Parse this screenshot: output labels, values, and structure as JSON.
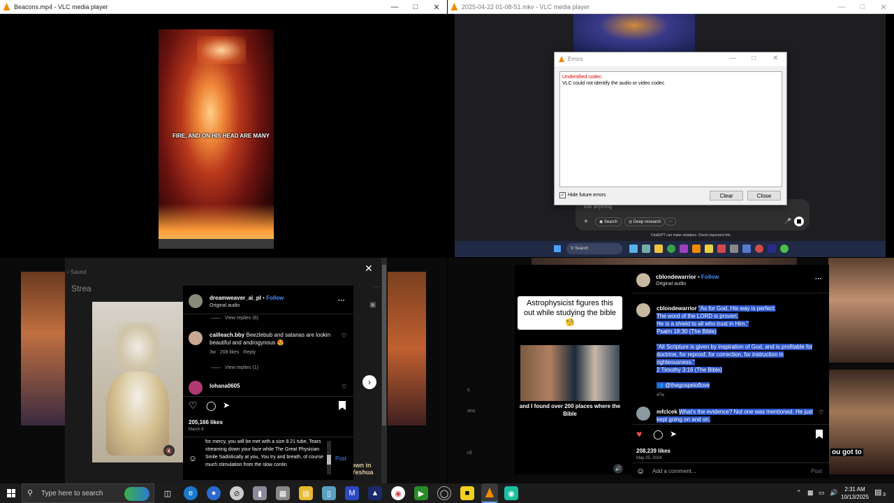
{
  "win1": {
    "title": "Beacons.mp4 - VLC media player"
  },
  "win2": {
    "title": "2025-04-22 01-08-51.mkv - VLC media player"
  },
  "video1": {
    "subtitle": "FIRE, AND ON HIS HEAD ARE MANY"
  },
  "errors_dialog": {
    "title": "Errors",
    "error_heading": "Undentified codec:",
    "error_body": "VLC could not identify the audio or video codec",
    "hide_label": "Hide future errors",
    "clear_label": "Clear",
    "close_label": "Close"
  },
  "chatgpt": {
    "placeholder": "Ask anything",
    "search_label": "Search",
    "deep_research_label": "Deep research",
    "more_label": "···",
    "disclaimer": "ChatGPT can make mistakes. Check important info.",
    "taskbar_search": "Search"
  },
  "ig_left": {
    "saved_label": "Saved",
    "partial_title": "Strea",
    "username": "dreamweaver_ai_pl",
    "follow_label": "Follow",
    "audio_label": "Original audio",
    "view_replies_top": "View replies (6)",
    "comment1_user": "cailleach.bby",
    "comment1_text": "Beezlebub and satanas are lookin beautiful and androgynous 😍",
    "comment1_age": "3w",
    "comment1_likes": "208 likes",
    "comment1_reply": "Reply",
    "view_replies_2": "View replies (1)",
    "comment2_user": "lohana0605",
    "likes": "205,166 likes",
    "date": "March 8",
    "input_text": "for mercy, you will be met with a size 8 21 tube, Tears streaming down your face while The Great Physician Smile Sadistically at you, You try and breath, of course much stimulation from the slow contin",
    "post_label": "Post",
    "bg_text": "own in Yeshua"
  },
  "ig_right": {
    "video_caption_top": "Astrophysicist figures this out while studying the bible🧐",
    "video_caption_bottom": "and I found over 200 places where the Bible",
    "username": "cblondewarrior",
    "follow_label": "Follow",
    "audio_label": "Original audio",
    "caption_user": "cblondewarrior",
    "caption_lines": [
      "\"As for God, His way is perfect;",
      "The word of the LORD is proven;",
      "He is a shield to all who trust in Him.\"",
      "Psalm 18:30 (The Bible)",
      "",
      "\"All Scripture is given by inspiration of God, and is profitable for",
      "doctrine, for reproof, for correction, for instruction in",
      "righteousness.\"",
      "2 Timothy 3:16 (The Bible)",
      "",
      "👥 @thegospeloflove"
    ],
    "caption_age": "47w",
    "comment_user": "mfclcek",
    "comment_text": "What's the evidence? Not one was mentioned. He just kept going on and on.",
    "likes": "208,239 likes",
    "date": "May 25, 2024",
    "add_comment_placeholder": "Add a comment...",
    "post_label": "Post",
    "side_text_1": "s",
    "side_text_2": "ons",
    "side_text_3": "rd",
    "bg_text": "ou got to"
  },
  "taskbar": {
    "search_placeholder": "Type here to search",
    "time": "2:31 AM",
    "date": "10/13/2025",
    "notif_count": "3"
  },
  "colors": {
    "ig_blue": "#4a8df8",
    "vlc_orange": "#f08a00",
    "error_red": "#e00000",
    "highlight": "#2b55c9"
  }
}
